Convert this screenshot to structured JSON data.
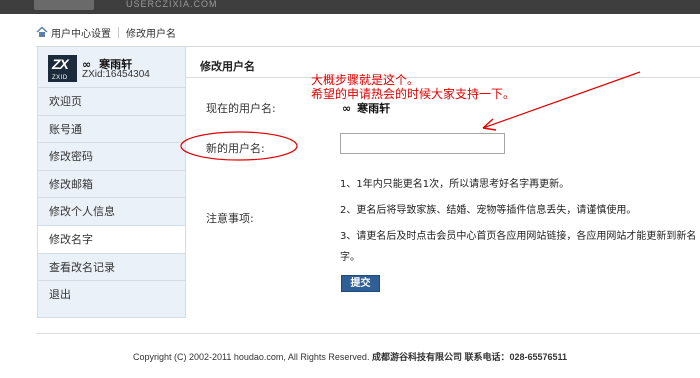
{
  "header": {
    "logo_text": "USERCZIXIA.COM"
  },
  "breadcrumb": {
    "items": [
      "用户中心设置",
      "修改用户名"
    ]
  },
  "profile": {
    "avatar_text": "ZX",
    "avatar_sub": "ZXID",
    "name_prefix": "∞",
    "name": "寒雨轩",
    "id": "ZXid:16454304"
  },
  "sidebar": {
    "items": [
      {
        "label": "欢迎页"
      },
      {
        "label": "账号通"
      },
      {
        "label": "修改密码"
      },
      {
        "label": "修改邮箱"
      },
      {
        "label": "修改个人信息"
      },
      {
        "label": "修改名字"
      },
      {
        "label": "查看改名记录"
      },
      {
        "label": "退出"
      }
    ],
    "active_index": 5
  },
  "main": {
    "title": "修改用户名",
    "current_name_label": "现在的用户名:",
    "current_name_prefix": "∞",
    "current_name": "寒雨轩",
    "new_name_label": "新的用户名:",
    "new_name_value": "",
    "notes_label": "注意事项:",
    "notes": [
      "1、1年内只能更名1次，所以请思考好名字再更新。",
      "2、更名后将导致家族、结婚、宠物等插件信息丢失，请谨慎使用。",
      "3、请更名后及时点击会员中心首页各应用网站链接，各应用网站才能更新到新名字。"
    ],
    "submit_label": "提交"
  },
  "annotation": {
    "lines": [
      "大概步骤就是这个。",
      "希望的申请热会的时候大家支持一下。"
    ],
    "color": "#e30000"
  },
  "footer": {
    "copyright": "Copyright (C) 2002-2011 houdao.com, All Rights Reserved. ",
    "company": "成都游谷科技有限公司 联系电话：028-65576511"
  },
  "colors": {
    "accent": "#2f5f96",
    "sidebar_bg": "#ebf1f8",
    "annotation": "#e30000"
  }
}
